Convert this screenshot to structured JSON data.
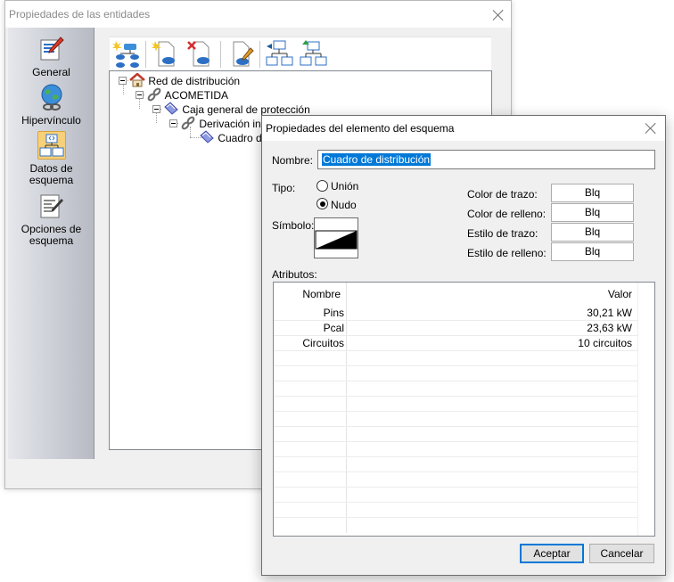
{
  "back_window": {
    "title": "Propiedades de las entidades",
    "sidebar": {
      "items": [
        {
          "icon": "edit-page-icon",
          "label": "General"
        },
        {
          "icon": "globe-link-icon",
          "label": "Hipervínculo"
        },
        {
          "icon": "schema-data-icon",
          "label_line1": "Datos de",
          "label_line2": "esquema"
        },
        {
          "icon": "options-page-icon",
          "label_line1": "Opciones de",
          "label_line2": "esquema"
        }
      ]
    },
    "toolbar": {
      "buttons": [
        "new-branch-icon",
        "new-node-icon",
        "delete-node-icon",
        "edit-node-icon",
        "move-left-icon",
        "move-up-icon"
      ]
    },
    "tree": {
      "nodes": [
        {
          "label": "Red de distribución",
          "icon": "house-icon"
        },
        {
          "label": "ACOMETIDA",
          "icon": "link-icon"
        },
        {
          "label": "Caja general de protección",
          "icon": "node-diamond-icon"
        },
        {
          "label": "Derivación indivi",
          "icon": "link-icon"
        },
        {
          "label": "Cuadro de",
          "icon": "node-diamond-icon"
        }
      ]
    }
  },
  "dialog": {
    "title": "Propiedades del elemento del esquema",
    "nombre_label": "Nombre:",
    "nombre_value": "Cuadro de distribución",
    "tipo_label": "Tipo:",
    "tipo_options": [
      "Unión",
      "Nudo"
    ],
    "tipo_selected": "Nudo",
    "simbolo_label": "Símbolo:",
    "style_props": [
      {
        "label": "Color de trazo:",
        "value": "Blq"
      },
      {
        "label": "Color de relleno:",
        "value": "Blq"
      },
      {
        "label": "Estilo de trazo:",
        "value": "Blq"
      },
      {
        "label": "Estilo de relleno:",
        "value": "Blq"
      }
    ],
    "atributos_label": "Atributos:",
    "grid": {
      "headers": [
        "Nombre",
        "Valor"
      ],
      "rows": [
        {
          "name": "Pins",
          "value": "30,21 kW"
        },
        {
          "name": "Pcal",
          "value": "23,63 kW"
        },
        {
          "name": "Circuitos",
          "value": "10 circuitos"
        }
      ]
    },
    "accept_label": "Aceptar",
    "cancel_label": "Cancelar"
  },
  "colors": {
    "accent": "#0078d7",
    "selected_sidebar": "#f7d07a"
  }
}
